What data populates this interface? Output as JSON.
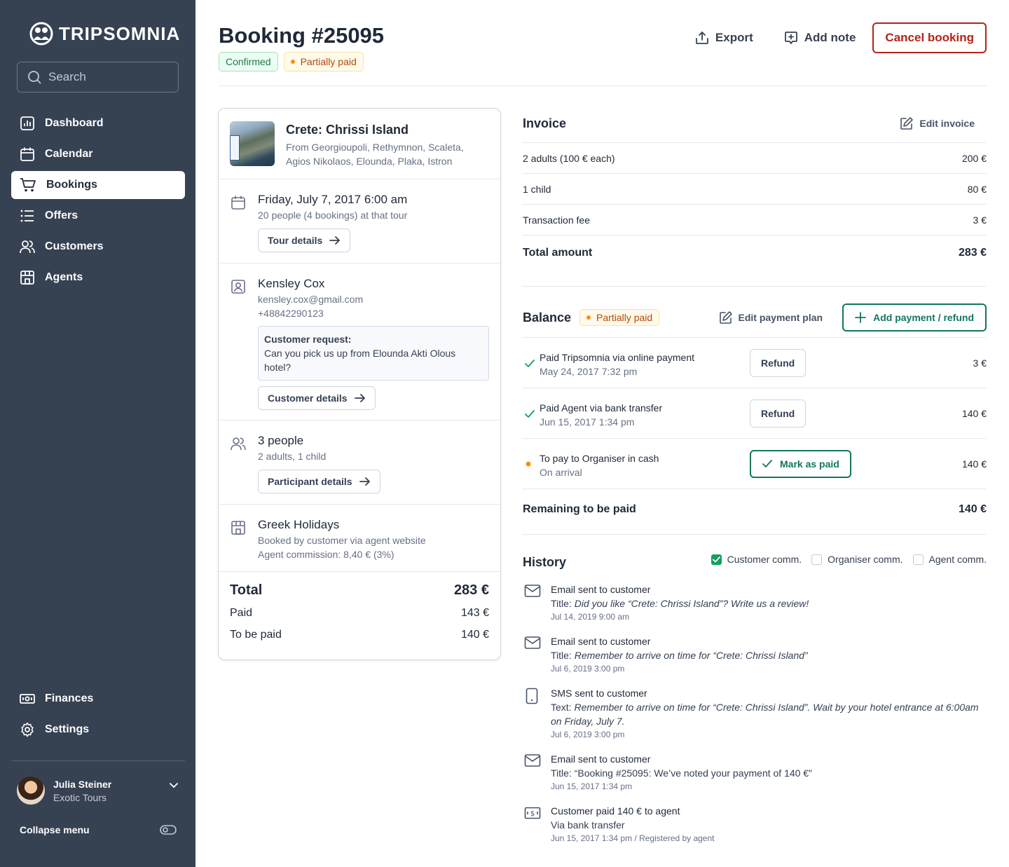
{
  "sidebar": {
    "brand": "TRIPSOMNIA",
    "search_placeholder": "Search",
    "nav": [
      {
        "label": "Dashboard",
        "icon": "chart-icon"
      },
      {
        "label": "Calendar",
        "icon": "calendar-icon"
      },
      {
        "label": "Bookings",
        "icon": "cart-icon",
        "active": true
      },
      {
        "label": "Offers",
        "icon": "list-icon"
      },
      {
        "label": "Customers",
        "icon": "users-icon"
      },
      {
        "label": "Agents",
        "icon": "building-icon"
      }
    ],
    "bottom_nav": [
      {
        "label": "Finances",
        "icon": "money-icon"
      },
      {
        "label": "Settings",
        "icon": "gear-icon"
      }
    ],
    "user": {
      "name": "Julia Steiner",
      "org": "Exotic Tours"
    },
    "collapse_label": "Collapse menu"
  },
  "header": {
    "title": "Booking #25095",
    "status_badge": "Confirmed",
    "payment_badge": "Partially paid",
    "export_label": "Export",
    "add_note_label": "Add note",
    "cancel_label": "Cancel booking"
  },
  "tour": {
    "name": "Crete: Chrissi Island",
    "from_line1": "From Georgioupoli, Rethymnon, Scaleta,",
    "from_line2": "Agios Nikolaos, Elounda, Plaka, Istron"
  },
  "schedule": {
    "datetime": "Friday, July 7, 2017 6:00 am",
    "info": "20 people (4 bookings) at that tour",
    "button": "Tour details"
  },
  "customer": {
    "name": "Kensley Cox",
    "email": "kensley.cox@gmail.com",
    "phone": "+48842290123",
    "request_label": "Customer request:",
    "request_text": "Can you pick us up from Elounda Akti Olous hotel?",
    "button": "Customer details"
  },
  "participants": {
    "count": "3 people",
    "breakdown": "2 adults, 1 child",
    "button": "Participant details"
  },
  "agent": {
    "name": "Greek Holidays",
    "via": "Booked by customer via agent website",
    "commission": "Agent commission: 8,40 € (3%)"
  },
  "totals": {
    "total_label": "Total",
    "total_value": "283 €",
    "paid_label": "Paid",
    "paid_value": "143 €",
    "tobepaid_label": "To be paid",
    "tobepaid_value": "140 €"
  },
  "invoice": {
    "title": "Invoice",
    "edit_label": "Edit invoice",
    "rows": [
      {
        "label": "2 adults (100 € each)",
        "value": "200 €"
      },
      {
        "label": "1 child",
        "value": "80 €"
      },
      {
        "label": "Transaction fee",
        "value": "3 €"
      }
    ],
    "total_label": "Total amount",
    "total_value": "283 €"
  },
  "balance": {
    "title": "Balance",
    "badge": "Partially paid",
    "edit_plan_label": "Edit payment plan",
    "add_label": "Add payment / refund",
    "payments": [
      {
        "title": "Paid Tripsomnia via online payment",
        "date": "May 24, 2017 7:32 pm",
        "action": "Refund",
        "amount": "3 €",
        "status": "paid"
      },
      {
        "title": "Paid Agent via bank transfer",
        "date": "Jun 15, 2017 1:34 pm",
        "action": "Refund",
        "amount": "140 €",
        "status": "paid"
      },
      {
        "title": "To pay to Organiser in cash",
        "date": "On arrival",
        "action": "Mark as paid",
        "amount": "140 €",
        "status": "pending"
      }
    ],
    "remaining_label": "Remaining to be paid",
    "remaining_value": "140 €"
  },
  "history": {
    "title": "History",
    "filters": [
      {
        "label": "Customer comm.",
        "checked": true
      },
      {
        "label": "Organiser comm.",
        "checked": false
      },
      {
        "label": "Agent comm.",
        "checked": false
      }
    ],
    "items": [
      {
        "icon": "mail-icon",
        "title": "Email sent to customer",
        "prefix": "Title: ",
        "text": "Did you like “Crete: Chrissi Island”? Write us a review!",
        "date": "Jul 14, 2019 9:00 am"
      },
      {
        "icon": "mail-icon",
        "title": "Email sent to customer",
        "prefix": "Title: ",
        "text": "Remember to arrive on time for “Crete: Chrissi Island”",
        "date": "Jul 6, 2019 3:00 pm"
      },
      {
        "icon": "phone-icon",
        "title": "SMS sent to customer",
        "prefix": "Text: ",
        "text": "Remember to arrive on time for “Crete: Chrissi Island”. Wait by your hotel entrance at 6:00am on Friday, July 7.",
        "date": "Jul 6, 2019 3:00 pm"
      },
      {
        "icon": "mail-icon",
        "title": "Email sent to customer",
        "prefix": "Title: “Booking #25095: We’ve noted your payment of 140 €”",
        "text": "",
        "date": "Jun 15, 2017 1:34 pm"
      },
      {
        "icon": "cash-icon",
        "title": "Customer paid 140 € to agent",
        "prefix": "Via bank transfer",
        "text": "",
        "date": "Jun 15, 2017 1:34 pm / Registered by agent"
      }
    ]
  },
  "colors": {
    "sidebar": "#364152",
    "accent_green": "#11775f",
    "danger": "#b42318",
    "warning": "#f79009"
  }
}
